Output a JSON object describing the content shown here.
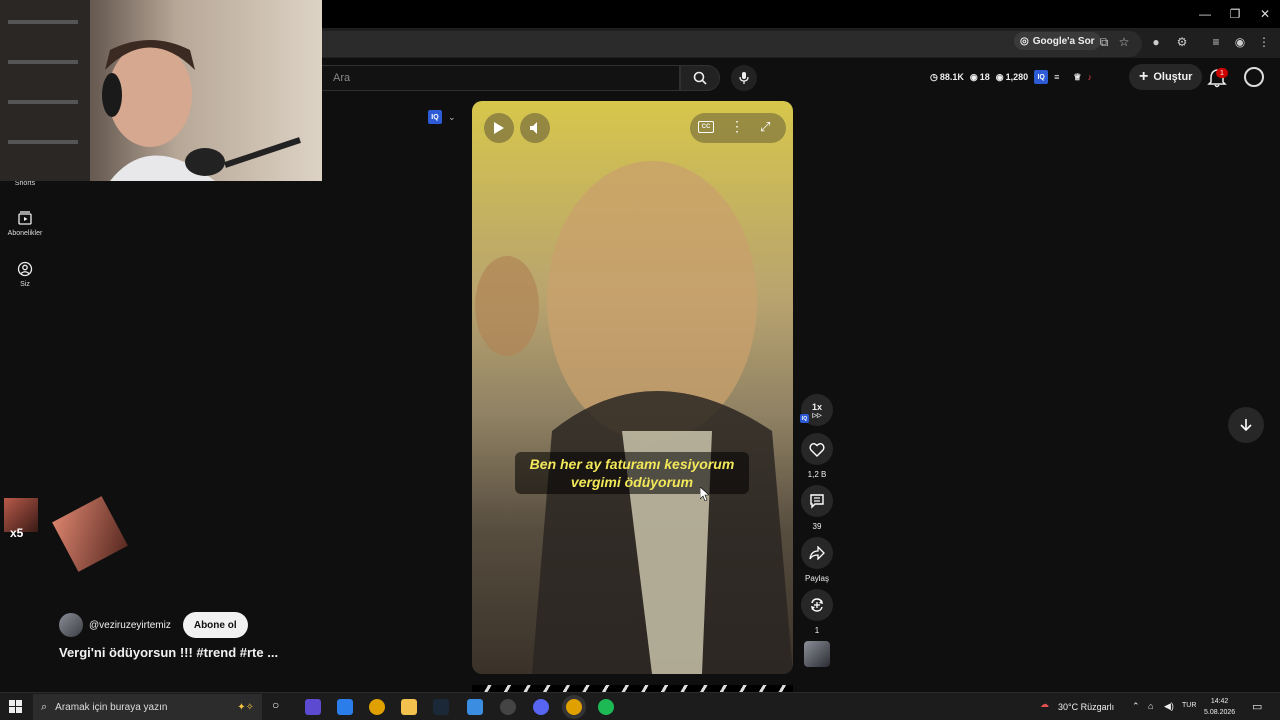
{
  "browser": {
    "ask_google": "Google'a Sor"
  },
  "header": {
    "search_placeholder": "Ara",
    "stats": {
      "views_left": "88.1K",
      "count_mid": "18",
      "count_right": "1,280"
    },
    "create_label": "Oluştur",
    "notification_count": "1"
  },
  "sidebar": {
    "items": [
      {
        "label": "Shorts",
        "icon": "shorts-icon"
      },
      {
        "label": "Abonelikler",
        "icon": "subscriptions-icon"
      },
      {
        "label": "Siz",
        "icon": "you-icon"
      }
    ]
  },
  "video": {
    "subtitle_line1": "Ben her ay faturamı kesiyorum",
    "subtitle_line2": "vergimi ödüyorum",
    "progress": 0.37,
    "cc_label": "CC"
  },
  "actions": {
    "speed": "1x",
    "likes": "1,2 B",
    "comments": "39",
    "share": "Paylaş",
    "remix": "1"
  },
  "channel": {
    "handle": "@veziruzeyirtemiz",
    "subscribe": "Abone ol",
    "title": "Vergi'ni ödüyorsun !!! #trend #rte ..."
  },
  "overlay": {
    "emote_multiplier": "x5"
  },
  "taskbar": {
    "search_placeholder": "Aramak için buraya yazın",
    "weather": "30°C  Rüzgarlı",
    "language": "TUR",
    "time": "14:42",
    "date": "5.08.2026"
  },
  "colors": {
    "accent_red": "#ff0033",
    "subtitle_yellow": "#f3e85a",
    "iq_blue": "#2d5bd6"
  }
}
